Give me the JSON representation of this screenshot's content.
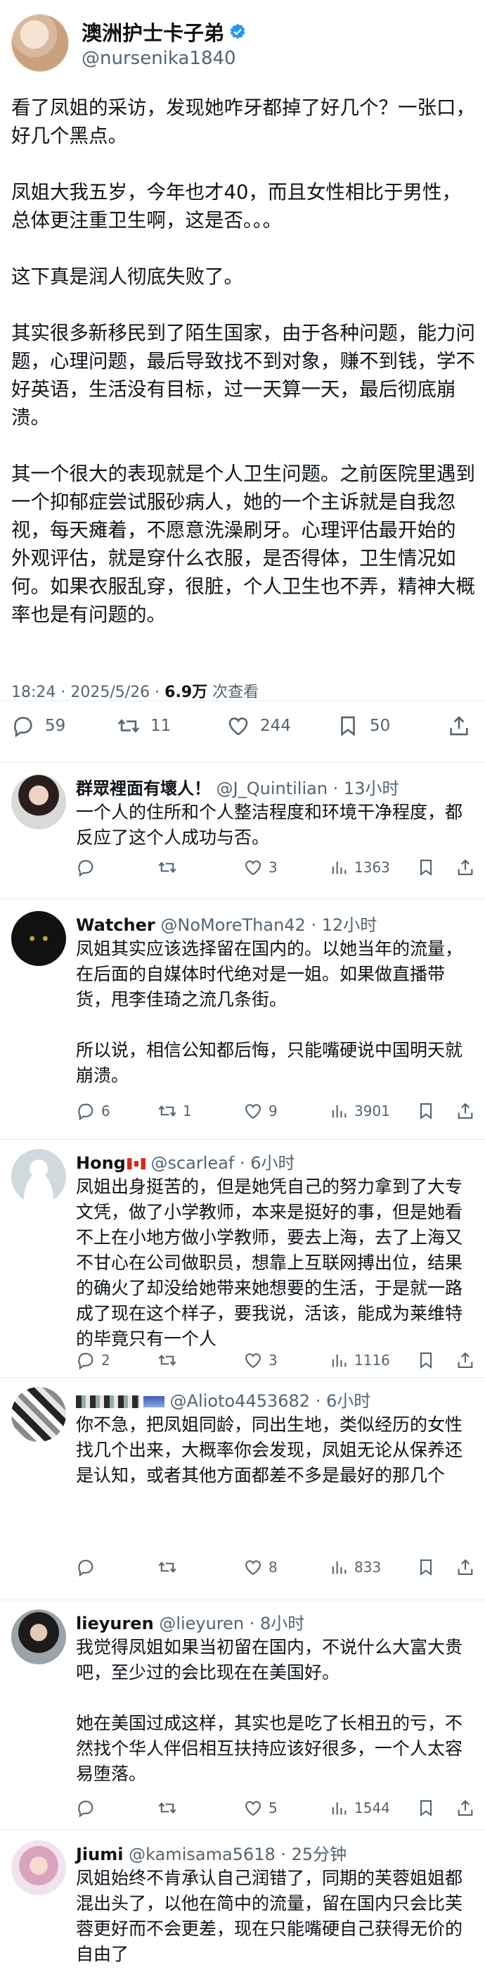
{
  "author": {
    "name": "澳洲护士卡子弟",
    "handle": "@nursenika1840"
  },
  "post": {
    "paragraphs": [
      "看了凤姐的采访，发现她咋牙都掉了好几个？一张口，好几个黑点。",
      "凤姐大我五岁，今年也才40，而且女性相比于男性，总体更注重卫生啊，这是否。。。",
      "这下真是润人彻底失败了。",
      "其实很多新移民到了陌生国家，由于各种问题，能力问题，心理问题，最后导致找不到对象，赚不到钱，学不好英语，生活没有目标，过一天算一天，最后彻底崩溃。",
      "其一个很大的表现就是个人卫生问题。之前医院里遇到一个抑郁症尝试服砂病人，她的一个主诉就是自我忽视，每天瘫着，不愿意洗澡刷牙。心理评估最开始的 外观评估，就是穿什么衣服，是否得体，卫生情况如何。如果衣服乱穿，很脏，个人卫生也不弄，精神大概率也是有问题的。"
    ],
    "time": "18:24 · 2025/5/26 · ",
    "views": "6.9万",
    "views_label": " 次查看",
    "replies": "59",
    "reposts": "11",
    "likes": "244",
    "bookmarks": "50"
  },
  "replies": [
    {
      "name": "群眾裡面有壞人！",
      "handle": "@J_Quintilian · 13小时",
      "text": [
        "一个人的住所和个人整洁程度和环境干净程度，都反应了这个人成功与否。"
      ],
      "reply_count": "",
      "repost_count": "",
      "like_count": "3",
      "view_count": "1363"
    },
    {
      "name": "Watcher",
      "handle": "@NoMoreThan42 · 12小时",
      "text": [
        "凤姐其实应该选择留在国内的。以她当年的流量，在后面的自媒体时代绝对是一姐。如果做直播带货，甩李佳琦之流几条街。",
        "",
        "所以说，相信公知都后悔，只能嘴硬说中国明天就崩溃。"
      ],
      "reply_count": "6",
      "repost_count": "1",
      "like_count": "9",
      "view_count": "3901"
    },
    {
      "name": "Hong",
      "handle": "@scarleaf · 6小时",
      "text": [
        "凤姐出身挺苦的，但是她凭自己的努力拿到了大专文凭，做了小学教师，本来是挺好的事，但是她看不上在小地方做小学教师，要去上海，去了上海又不甘心在公司做职员，想靠上互联网搏出位，结果的确火了却没给她带来她想要的生活，于是就一路成了现在这个样子，要我说，活该，能成为莱维特的毕竟只有一个人"
      ],
      "reply_count": "2",
      "repost_count": "",
      "like_count": "3",
      "view_count": "1116"
    },
    {
      "name": "",
      "handle": "@Alioto4453682 · 6小时",
      "text": [
        "你不急，把凤姐同龄，同出生地，类似经历的女性找几个出来，大概率你会发现，凤姐无论从保养还是认知，或者其他方面都差不多是最好的那几个"
      ],
      "reply_count": "",
      "repost_count": "",
      "like_count": "8",
      "view_count": "833"
    },
    {
      "name": "lieyuren",
      "handle": "@lieyuren · 8小时",
      "text": [
        "我觉得凤姐如果当初留在国内，不说什么大富大贵吧，至少过的会比现在在美国好。",
        "",
        "她在美国过成这样，其实也是吃了长相丑的亏，不然找个华人伴侣相互扶持应该好很多，一个人太容易堕落。"
      ],
      "reply_count": "",
      "repost_count": "",
      "like_count": "5",
      "view_count": "1544"
    },
    {
      "name": "Jiumi",
      "handle": "@kamisama5618 · 25分钟",
      "text": [
        "凤姐始终不肯承认自己润错了，同期的芙蓉姐姐都混出头了，以他在简中的流量，留在国内只会比芙蓉更好而不会更差，现在只能嘴硬自己获得无价的自由了"
      ],
      "reply_count": "",
      "repost_count": "",
      "like_count": "",
      "view_count": ""
    }
  ]
}
